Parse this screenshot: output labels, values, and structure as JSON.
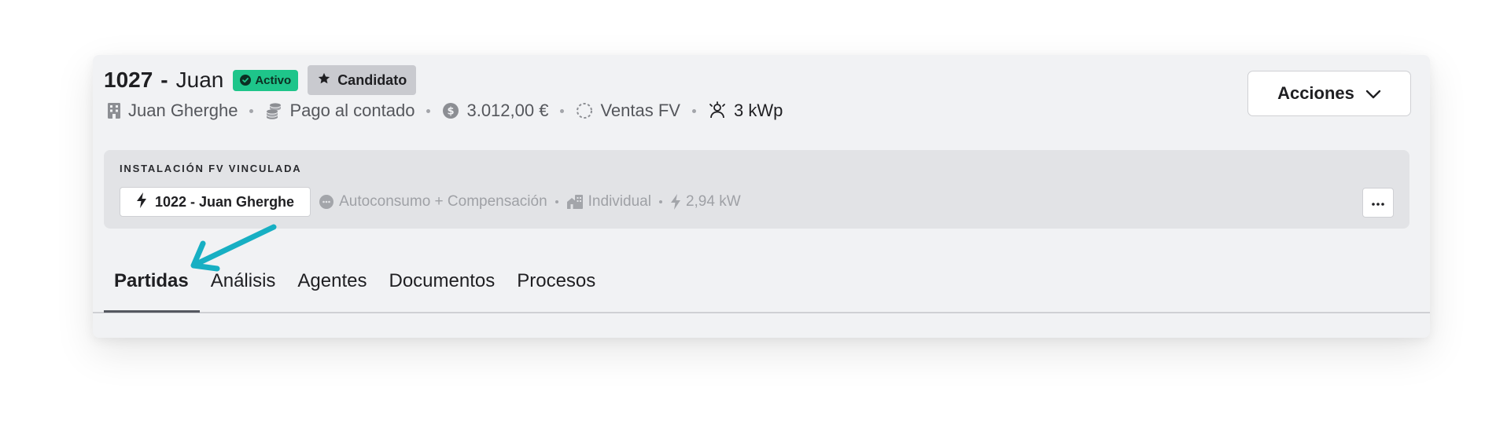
{
  "header": {
    "record_id": "1027",
    "separator": "-",
    "name": "Juan",
    "status_badge": "Activo",
    "candidate_badge": "Candidato",
    "actions_label": "Acciones"
  },
  "meta": {
    "client": "Juan Gherghe",
    "payment": "Pago al contado",
    "amount": "3.012,00 €",
    "pipeline": "Ventas FV",
    "power": "3 kWp"
  },
  "installation": {
    "section_label": "INSTALACIÓN FV VINCULADA",
    "link_label": "1022 - Juan Gherghe",
    "mode": "Autoconsumo + Compensación",
    "type": "Individual",
    "power": "2,94 kW"
  },
  "tabs": [
    {
      "label": "Partidas",
      "active": true
    },
    {
      "label": "Análisis",
      "active": false
    },
    {
      "label": "Agentes",
      "active": false
    },
    {
      "label": "Documentos",
      "active": false
    },
    {
      "label": "Procesos",
      "active": false
    }
  ],
  "colors": {
    "status_active": "#1ec58a",
    "candidate_bg": "#c9cacf",
    "annotation_arrow": "#17afc3",
    "card_bg": "#f1f2f4"
  },
  "icons": {
    "client": "building-icon",
    "payment": "coins-icon",
    "amount": "dollar-circle-icon",
    "pipeline": "dashed-circle-icon",
    "power": "solar-user-icon",
    "link": "bolt-icon"
  }
}
